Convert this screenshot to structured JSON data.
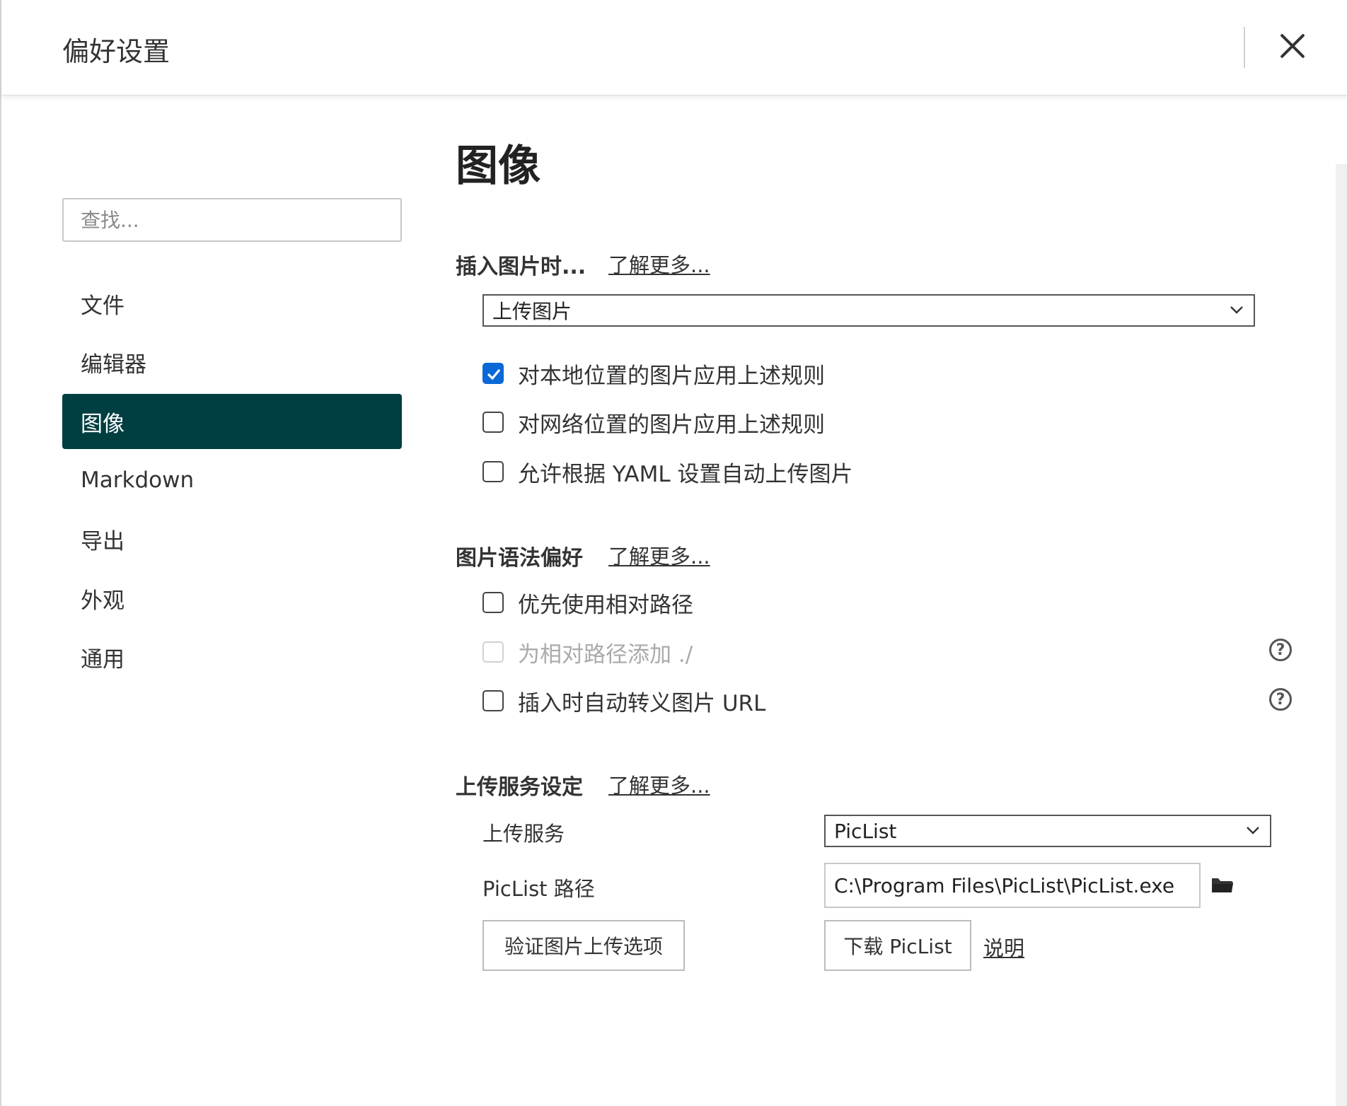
{
  "header": {
    "title": "偏好设置",
    "close_icon": "close-icon"
  },
  "sidebar": {
    "search_placeholder": "查找...",
    "items": [
      {
        "label": "文件",
        "active": false
      },
      {
        "label": "编辑器",
        "active": false
      },
      {
        "label": "图像",
        "active": true
      },
      {
        "label": "Markdown",
        "active": false
      },
      {
        "label": "导出",
        "active": false
      },
      {
        "label": "外观",
        "active": false
      },
      {
        "label": "通用",
        "active": false
      }
    ]
  },
  "main": {
    "page_title": "图像",
    "insert": {
      "title": "插入图片时...",
      "learn_more": "了解更多...",
      "action_value": "上传图片",
      "options": [
        {
          "label": "对本地位置的图片应用上述规则",
          "checked": true
        },
        {
          "label": "对网络位置的图片应用上述规则",
          "checked": false
        },
        {
          "label": "允许根据 YAML 设置自动上传图片",
          "checked": false
        }
      ]
    },
    "syntax": {
      "title": "图片语法偏好",
      "learn_more": "了解更多...",
      "options": [
        {
          "label": "优先使用相对路径",
          "checked": false,
          "disabled": false
        },
        {
          "label": "为相对路径添加 ./",
          "checked": false,
          "disabled": true,
          "help": "?"
        },
        {
          "label": "插入时自动转义图片 URL",
          "checked": false,
          "disabled": false,
          "help": "?"
        }
      ]
    },
    "upload": {
      "title": "上传服务设定",
      "learn_more": "了解更多...",
      "service_label": "上传服务",
      "service_value": "PicList",
      "path_label": "PicList 路径",
      "path_value": "C:\\Program Files\\PicList\\PicList.exe",
      "verify_button": "验证图片上传选项",
      "download_button": "下载 PicList",
      "help_link": "说明"
    }
  },
  "colors": {
    "active_nav_bg": "#003e41",
    "checkbox_checked": "#0b68d7"
  }
}
